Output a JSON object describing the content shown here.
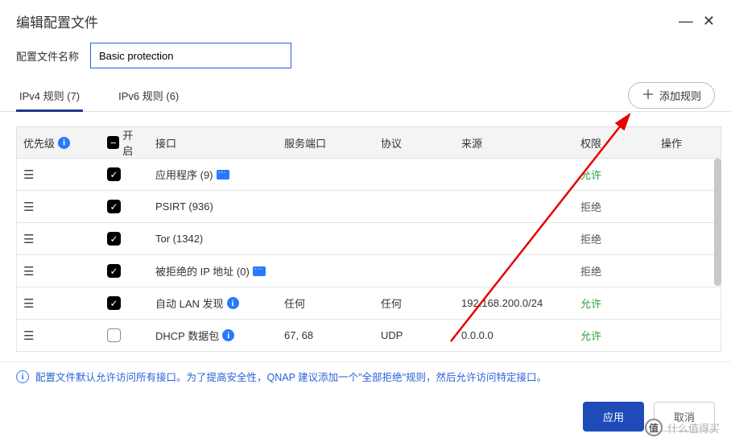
{
  "window": {
    "title": "编辑配置文件",
    "minimize": "—",
    "close": "✕"
  },
  "profile": {
    "name_label": "配置文件名称",
    "name_value": "Basic protection"
  },
  "tabs": {
    "ipv4": "IPv4 规则 (7)",
    "ipv6": "IPv6 规则 (6)"
  },
  "add_rule": "添加规则",
  "columns": {
    "priority": "优先级",
    "enabled": "开启",
    "interface": "接口",
    "port": "服务端口",
    "protocol": "协议",
    "source": "来源",
    "permission": "权限",
    "action": "操作"
  },
  "rows": [
    {
      "enabled": true,
      "interface": "应用程序 (9)",
      "chat": true,
      "info": false,
      "port": "",
      "protocol": "",
      "source": "",
      "perm_text": "允许",
      "perm_class": "allow"
    },
    {
      "enabled": true,
      "interface": "PSIRT (936)",
      "chat": false,
      "info": false,
      "port": "",
      "protocol": "",
      "source": "",
      "perm_text": "拒绝",
      "perm_class": "deny"
    },
    {
      "enabled": true,
      "interface": "Tor (1342)",
      "chat": false,
      "info": false,
      "port": "",
      "protocol": "",
      "source": "",
      "perm_text": "拒绝",
      "perm_class": "deny"
    },
    {
      "enabled": true,
      "interface": "被拒绝的 IP 地址 (0)",
      "chat": true,
      "info": false,
      "port": "",
      "protocol": "",
      "source": "",
      "perm_text": "拒绝",
      "perm_class": "deny"
    },
    {
      "enabled": true,
      "interface": "自动 LAN 发现",
      "chat": false,
      "info": true,
      "port": "任何",
      "protocol": "任何",
      "source": "192.168.200.0/24",
      "perm_text": "允许",
      "perm_class": "allow"
    },
    {
      "enabled": false,
      "interface": "DHCP 数据包",
      "chat": false,
      "info": true,
      "port": "67, 68",
      "protocol": "UDP",
      "source": "0.0.0.0",
      "perm_text": "允许",
      "perm_class": "allow"
    }
  ],
  "note": "配置文件默认允许访问所有接口。为了提高安全性，QNAP 建议添加一个\"全部拒绝\"规则，然后允许访问特定接口。",
  "buttons": {
    "apply": "应用",
    "cancel": "取消"
  },
  "watermark": "什么值得买"
}
